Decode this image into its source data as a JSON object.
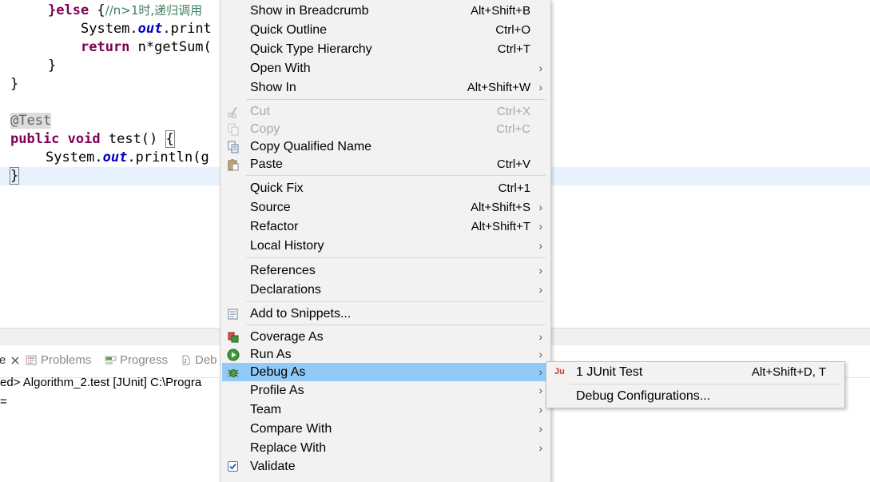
{
  "editor": {
    "line1": {
      "else_kw": "}else",
      "brace": " {",
      "comment": "//n>1时,递归调用"
    },
    "line2": {
      "pre": "System.",
      "field": "out",
      "post": ".print"
    },
    "line3": {
      "kw": "return",
      "post": " n*getSum("
    },
    "line4": "}",
    "line5": "}",
    "line6": {
      "at": "@",
      "name": "Test"
    },
    "line7": {
      "kw1": "public",
      "kw2": "void",
      "mid": " test() ",
      "brace": "{"
    },
    "line8": {
      "pre": "System.",
      "field": "out",
      "post": ".println(g"
    },
    "line9": "}"
  },
  "panel": {
    "tabs": [
      {
        "label": "e"
      },
      {
        "label": "Problems"
      },
      {
        "label": "Progress"
      },
      {
        "label": "Deb"
      }
    ],
    "console_header": "ed> Algorithm_2.test [JUnit] C:\\Progra",
    "console_output": "="
  },
  "menu": {
    "items": [
      {
        "label": "Show in Breadcrumb",
        "accel": "Alt+Shift+B"
      },
      {
        "label": "Quick Outline",
        "accel": "Ctrl+O"
      },
      {
        "label": "Quick Type Hierarchy",
        "accel": "Ctrl+T"
      },
      {
        "label": "Open With",
        "accel": ""
      },
      {
        "label": "Show In",
        "accel": "Alt+Shift+W"
      },
      {
        "label": "Cut",
        "accel": "Ctrl+X"
      },
      {
        "label": "Copy",
        "accel": "Ctrl+C"
      },
      {
        "label": "Copy Qualified Name",
        "accel": ""
      },
      {
        "label": "Paste",
        "accel": "Ctrl+V"
      },
      {
        "label": "Quick Fix",
        "accel": "Ctrl+1"
      },
      {
        "label": "Source",
        "accel": "Alt+Shift+S"
      },
      {
        "label": "Refactor",
        "accel": "Alt+Shift+T"
      },
      {
        "label": "Local History",
        "accel": ""
      },
      {
        "label": "References",
        "accel": ""
      },
      {
        "label": "Declarations",
        "accel": ""
      },
      {
        "label": "Add to Snippets...",
        "accel": ""
      },
      {
        "label": "Coverage As",
        "accel": ""
      },
      {
        "label": "Run As",
        "accel": ""
      },
      {
        "label": "Debug As",
        "accel": ""
      },
      {
        "label": "Profile As",
        "accel": ""
      },
      {
        "label": "Team",
        "accel": ""
      },
      {
        "label": "Compare With",
        "accel": ""
      },
      {
        "label": "Replace With",
        "accel": ""
      },
      {
        "label": "Validate",
        "accel": ""
      }
    ],
    "submenu_arrow": "›"
  },
  "submenu": {
    "items": [
      {
        "icon_text": "Ju",
        "label": "1 JUnit Test",
        "accel": "Alt+Shift+D, T"
      },
      {
        "icon_text": "",
        "label": "Debug Configurations...",
        "accel": ""
      }
    ]
  },
  "colors": {
    "menu_background": "#f2f2f2",
    "highlight": "#91c9f7",
    "keyword": "#7f0055",
    "field": "#0000c0",
    "comment": "#3f7f5f"
  },
  "icons": {
    "panel_close": "close-icon",
    "problems": "problems-icon",
    "progress": "progress-icon",
    "debug": "debug-icon",
    "cut": "scissors-icon",
    "copy": "copy-icon",
    "copy_qualified": "copy-qualified-icon",
    "paste": "paste-icon",
    "snippets": "snippets-icon",
    "coverage": "coverage-icon",
    "run": "run-icon",
    "debug_as": "bug-icon",
    "validate": "checkbox-checked-icon",
    "junit": "junit-icon"
  }
}
